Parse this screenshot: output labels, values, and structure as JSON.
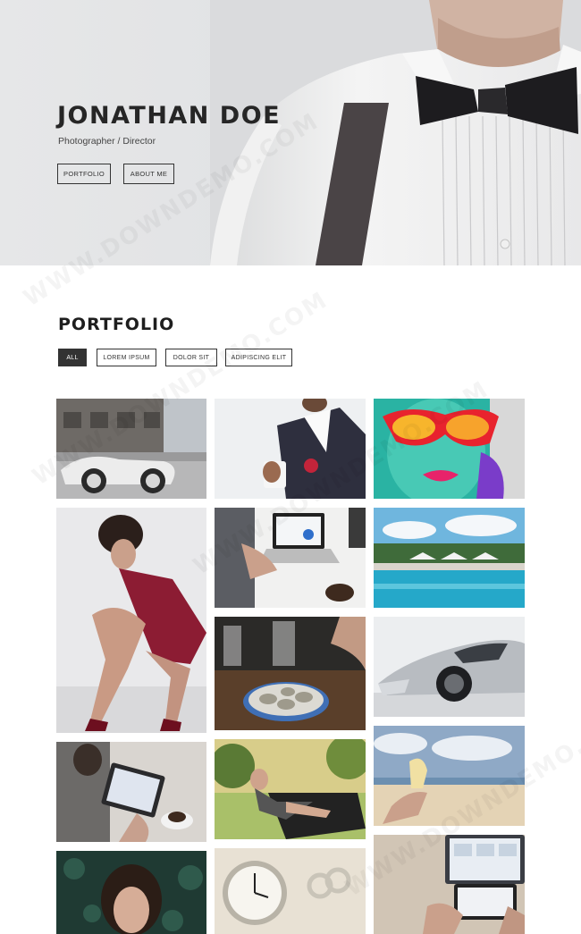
{
  "hero": {
    "name": "JONATHAN DOE",
    "subtitle": "Photographer / Director",
    "buttons": {
      "portfolio": "PORTFOLIO",
      "about": "ABOUT ME"
    }
  },
  "portfolio": {
    "title": "PORTFOLIO",
    "filters": [
      "ALL",
      "LOREM IPSUM",
      "DOLOR SIT",
      "ADIPISCING ELIT"
    ],
    "active_filter": "ALL",
    "items": [
      "vintage-car-street",
      "man-coffee-suit",
      "graffiti-face",
      "woman-red-dress",
      "laptop-desk-coffee",
      "resort-pool",
      "oysters-table",
      "silver-sports-car",
      "tablet-coffee",
      "woman-motorcycle",
      "beach-drink",
      "woman-portrait-leaves",
      "watch-rings",
      "laptop-hands"
    ]
  },
  "watermark": "WWW.DOWNDEMO.COM",
  "colors": {
    "accent": "#333333",
    "hero_bg": "#e4e5e7",
    "page_bg": "#ffffff"
  }
}
